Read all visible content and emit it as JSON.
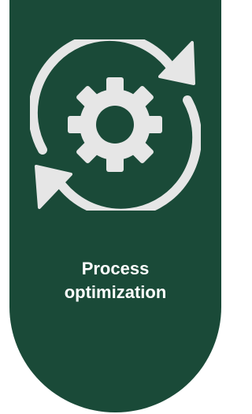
{
  "card": {
    "title_line1": "Process",
    "title_line2": "optimization",
    "icon": "gear-cycle-icon",
    "background_color": "#1a4a38",
    "icon_color": "#e6e6e6",
    "text_color": "#ffffff"
  }
}
